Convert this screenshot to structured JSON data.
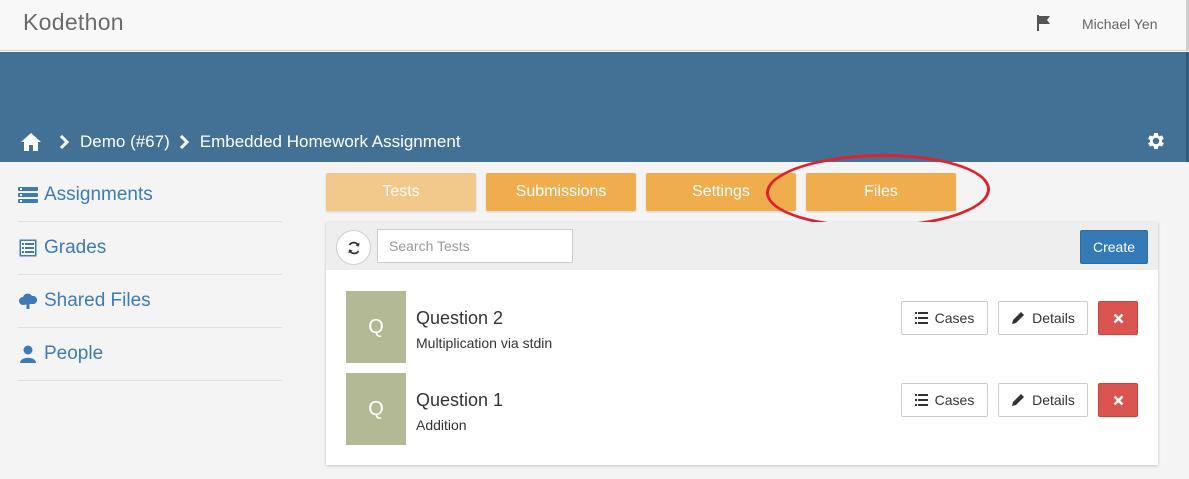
{
  "app": {
    "brand": "Kodethon",
    "user_name": "Michael Yen"
  },
  "breadcrumb": {
    "course": "Demo (#67)",
    "assignment": "Embedded Homework Assignment"
  },
  "sidebar": {
    "items": [
      {
        "label": "Assignments",
        "icon": "tasks-icon"
      },
      {
        "label": "Grades",
        "icon": "list-alt-icon"
      },
      {
        "label": "Shared Files",
        "icon": "cloud-upload-icon"
      },
      {
        "label": "People",
        "icon": "user-icon"
      }
    ]
  },
  "tabs": [
    {
      "label": "Tests",
      "state": "current"
    },
    {
      "label": "Submissions"
    },
    {
      "label": "Settings"
    },
    {
      "label": "Files",
      "annotated": true
    }
  ],
  "toolbar": {
    "search_placeholder": "Search Tests",
    "create_label": "Create"
  },
  "tests": [
    {
      "avatar": "Q",
      "title": "Question 2",
      "description": "Multiplication via stdin",
      "cases_label": "Cases",
      "details_label": "Details"
    },
    {
      "avatar": "Q",
      "title": "Question 1",
      "description": "Addition",
      "cases_label": "Cases",
      "details_label": "Details"
    }
  ],
  "colors": {
    "header_blue": "#437196",
    "tab_orange": "#efad4e",
    "tab_orange_light": "#f2c98b",
    "link_blue": "#3e7bb5",
    "primary": "#337ab7",
    "danger": "#d9534f",
    "avatar_bg": "#b2b994",
    "annotation_red": "#e0202a"
  }
}
